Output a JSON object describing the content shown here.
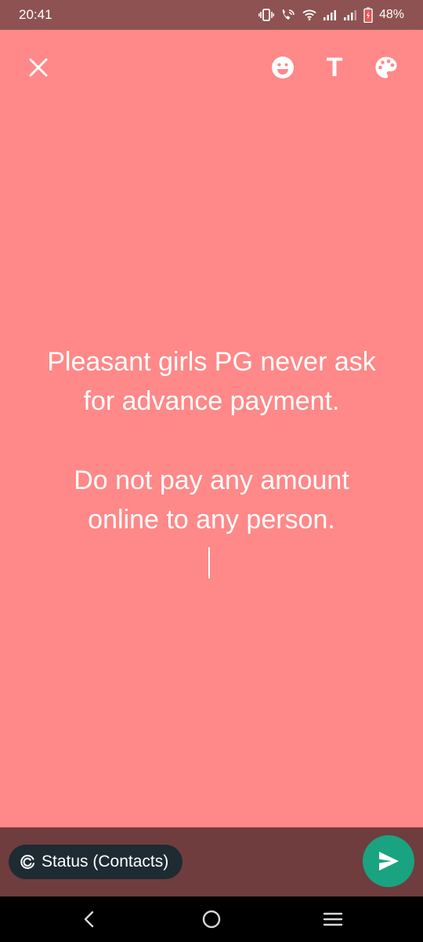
{
  "status_bar": {
    "time": "20:41",
    "battery": "48%",
    "icons": [
      "vibrate-icon",
      "wifi-call-icon",
      "wifi-icon",
      "signal-icon",
      "signal-icon-2",
      "battery-icon"
    ]
  },
  "toolbar": {
    "close_icon": "close-icon",
    "emoji_icon": "emoji-icon",
    "text_label": "T",
    "palette_icon": "palette-icon"
  },
  "status_text": {
    "line1": "Pleasant girls PG never ask",
    "line2": "for advance payment.",
    "line3": "Do not pay any amount",
    "line4": "online to any person."
  },
  "bottom_bar": {
    "audience_label": "Status (Contacts)",
    "send_icon": "send-icon"
  },
  "nav_bar": {
    "icons": [
      "back-icon",
      "home-icon",
      "recents-icon"
    ]
  },
  "colors": {
    "background": "#ff8888",
    "status_bar": "#8e5252",
    "bottom_bar": "#6f3d3d",
    "chip": "#1e2b33",
    "send_button": "#1aa380"
  }
}
